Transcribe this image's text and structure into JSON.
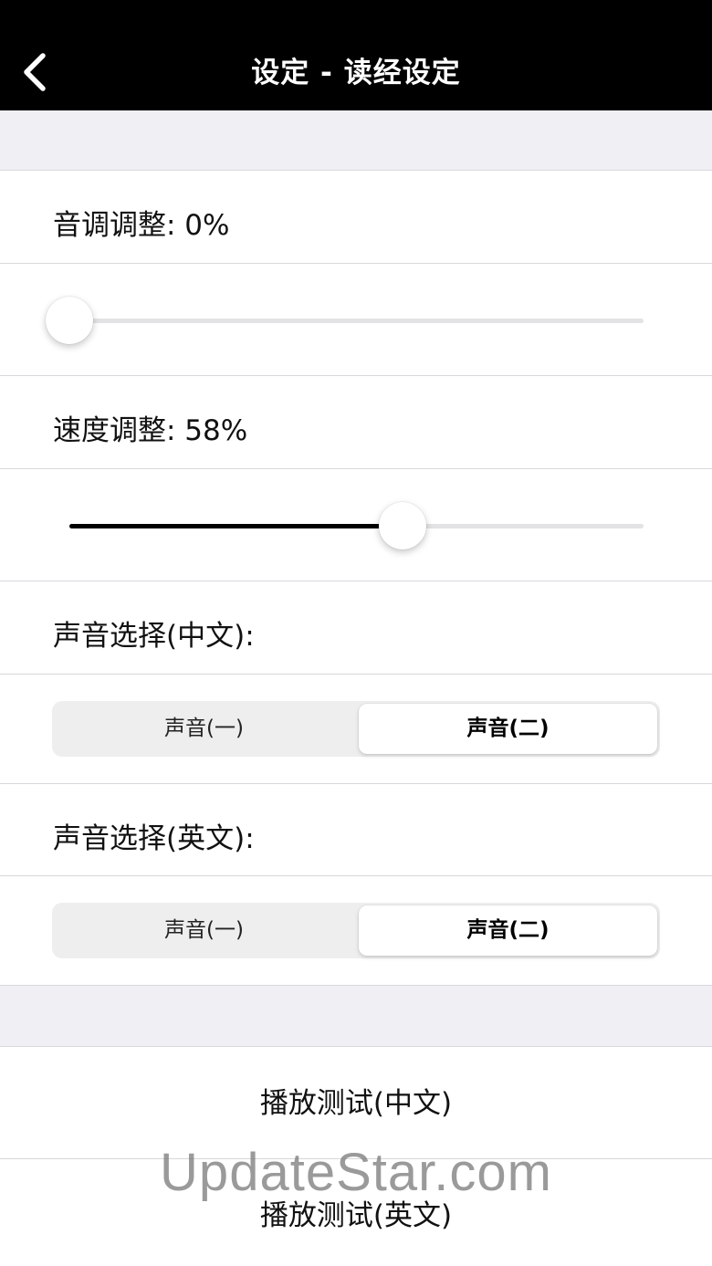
{
  "nav": {
    "title": "设定 - 读经设定",
    "back_icon": "chevron-left-icon"
  },
  "pitch": {
    "label": "音调调整: 0%",
    "value_percent": 0
  },
  "speed": {
    "label": "速度调整: 58%",
    "value_percent": 58
  },
  "voice_chinese": {
    "label": "声音选择(中文):",
    "options": [
      "声音(一)",
      "声音(二)"
    ],
    "selected": "声音(二)"
  },
  "voice_english": {
    "label": "声音选择(英文):",
    "options": [
      "声音(一)",
      "声音(二)"
    ],
    "selected": "声音(二)"
  },
  "actions": {
    "play_chinese": "播放测试(中文)",
    "play_english": "播放测试(英文)"
  },
  "watermark": "UpdateStar.com",
  "colors": {
    "navbar": "#000000",
    "background": "#efeff4",
    "slider_fill": "#000000"
  }
}
